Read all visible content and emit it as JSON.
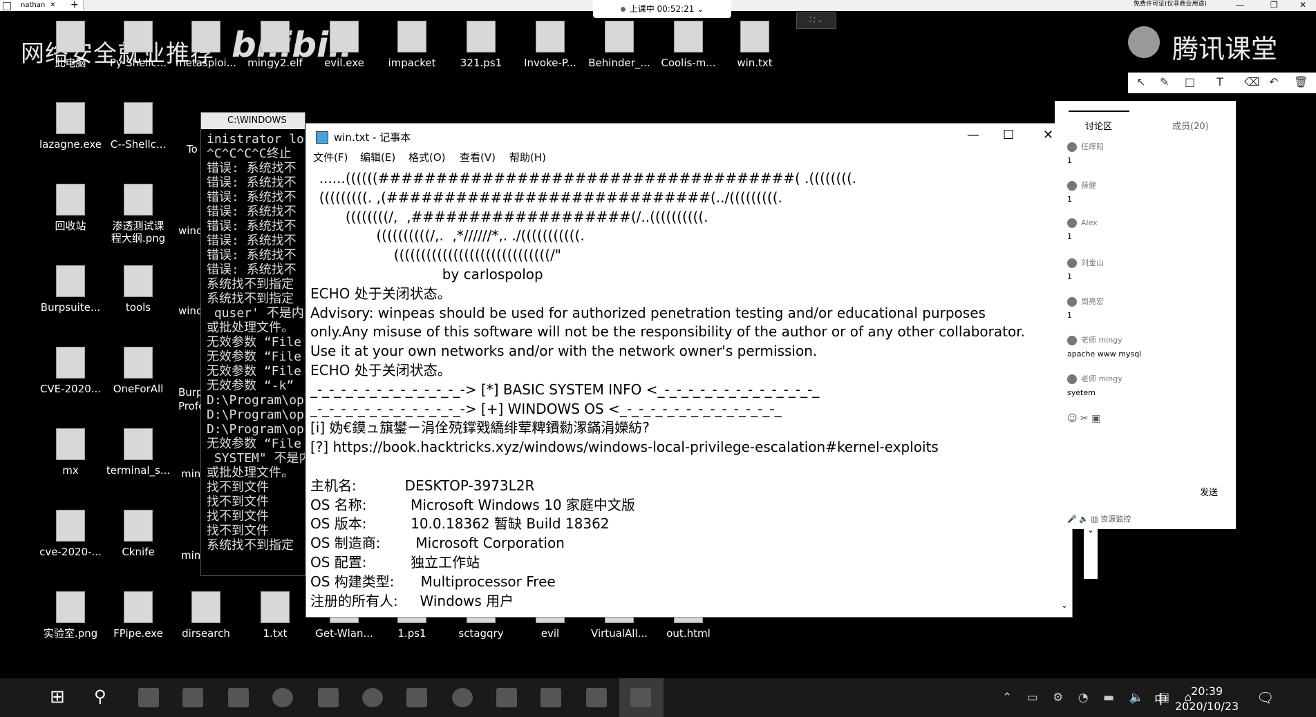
{
  "browser_tab": {
    "title": "nathan",
    "close": "✕",
    "plus": "+"
  },
  "live_status": "上课中 00:52:21",
  "license_text": "免费许可证(仅非商业用途)",
  "window_controls": {
    "minimize": "—",
    "restore": "❐",
    "close": "✕"
  },
  "watermark": {
    "text": "网络安全就业推荐",
    "bilibili": "bilibili",
    "tencent": "腾讯课堂"
  },
  "desktop_icons": [
    {
      "label": "此电脑"
    },
    {
      "label": "Py-Shellc..."
    },
    {
      "label": "metasploi..."
    },
    {
      "label": "mingy2.elf"
    },
    {
      "label": "evil.exe"
    },
    {
      "label": "impacket"
    },
    {
      "label": "321.ps1"
    },
    {
      "label": "Invoke-P..."
    },
    {
      "label": "Behinder_..."
    },
    {
      "label": "Coolis-m..."
    },
    {
      "label": "win.txt"
    },
    {
      "label": "lazagne.exe"
    },
    {
      "label": "C--Shellc..."
    },
    {
      "label": "回收站"
    },
    {
      "label": "渗透测试课\n程大纲.png"
    },
    {
      "label": "Burpsuite..."
    },
    {
      "label": "tools"
    },
    {
      "label": "CVE-2020..."
    },
    {
      "label": "OneForAll"
    },
    {
      "label": "mx"
    },
    {
      "label": "terminal_s..."
    },
    {
      "label": "cve-2020-..."
    },
    {
      "label": "Cknife"
    },
    {
      "label": "实验室.png"
    },
    {
      "label": "FPipe.exe"
    },
    {
      "label": "dirsearch"
    },
    {
      "label": "1.txt"
    },
    {
      "label": "Get-Wlan..."
    },
    {
      "label": "1.ps1"
    },
    {
      "label": "sctagqry"
    },
    {
      "label": "evil"
    },
    {
      "label": "VirtualAll..."
    },
    {
      "label": "out.html"
    }
  ],
  "partial_labels": [
    "To",
    "wind",
    "wind",
    "Burp\nProfe",
    "minc",
    "min"
  ],
  "cmd": {
    "title": "C:\\WINDOWS",
    "lines": [
      "inistrator log",
      "^C^C^C^C终止",
      "错误: 系统找不",
      "错误: 系统找不",
      "错误: 系统找不",
      "错误: 系统找不",
      "错误: 系统找不",
      "错误: 系统找不",
      "错误: 系统找不",
      "错误: 系统找不",
      "系统找不到指定",
      "系统找不到指定",
      " quser' 不是内",
      "或批处理文件。",
      "无效参数 “File",
      "无效参数 “File",
      "无效参数 “File",
      "无效参数 “-k”",
      "D:\\Program\\ope",
      "D:\\Program\\ope",
      "D:\\Program\\ope",
      "无效参数 “File",
      " SYSTEM\" 不是内",
      "或批处理文件。",
      "找不到文件",
      "找不到文件",
      "找不到文件",
      "找不到文件",
      "系统找不到指定"
    ]
  },
  "notepad": {
    "title": "win.txt - 记事本",
    "menu": [
      "文件(F)",
      "编辑(E)",
      "格式(O)",
      "查看(V)",
      "帮助(H)"
    ],
    "lines": [
      "  ......((((((####################################( .((((((((.",
      "  (((((((((. ,(############################(../(((((((((.",
      "        ((((((((/,  ,###################(/..((((((((((.",
      "               ((((((((((/,.  ,*//////*,. ./(((((((((((.",
      "                   (((((((((((((((((((((((((((((/\"",
      "                              by carlospolop",
      "ECHO 处于关闭状态。",
      "Advisory: winpeas should be used for authorized penetration testing and/or educational purposes",
      "only.Any misuse of this software will not be the responsibility of the author or of any other collaborator.",
      "Use it at your own networks and/or with the network owner's permission.",
      "ECHO 处于关闭状态。",
      "_-_-_-_-_-_-_-_-_-_-_-_-_-> [*] BASIC SYSTEM INFO <_-_-_-_-_-_-_-_-_-_-_-_-_-_",
      "_-_-_-_-_-_-_-_-_-_-_-_-_-> [+] WINDOWS OS <_-_-_-_-_-_-_-_-_-_-_-_-_-_",
      "[i] 妫€鏌ュ簱鐢ㄧ涓佺殑鐣戣繑绯荤粺鐨勬潈鏋涓嬫紡?",
      "[?] https://book.hacktricks.xyz/windows/windows-local-privilege-escalation#kernel-exploits",
      "",
      "主机名:           DESKTOP-3973L2R",
      "OS 名称:          Microsoft Windows 10 家庭中文版",
      "OS 版本:          10.0.18362 暂缺 Build 18362",
      "OS 制造商:        Microsoft Corporation",
      "OS 配置:          独立工作站",
      "OS 构建类型:      Multiprocessor Free",
      "注册的所有人:     Windows 用户"
    ]
  },
  "chat": {
    "tab_active": "讨论区",
    "tab_members": "成员(20)",
    "messages": [
      {
        "name": "任辉阳",
        "text": "1"
      },
      {
        "name": "薛健",
        "text": "1"
      },
      {
        "name": "Alex",
        "text": "1"
      },
      {
        "name": "刘金山",
        "text": "1"
      },
      {
        "name": "周亮宏",
        "text": "1"
      },
      {
        "name": "老师 mingy",
        "text": "apache www mysql"
      },
      {
        "name": "老师 mingy",
        "text": "syetem"
      }
    ],
    "icons": "☺  ✂  ▣",
    "send": "发送",
    "bottom": "🎤  🔈  ▥       资源监控"
  },
  "clock": {
    "time": "20:39",
    "date": "2020/10/23"
  },
  "ime": "中"
}
